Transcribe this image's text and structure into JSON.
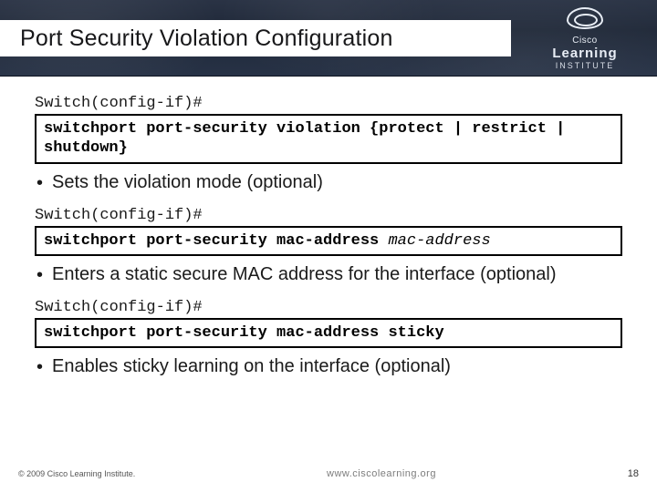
{
  "header": {
    "title": "Port Security Violation Configuration",
    "logo": {
      "brand": "Cisco",
      "word": "Learning",
      "sub": "INSTITUTE"
    }
  },
  "sections": [
    {
      "prompt": "Switch(config-if)#",
      "command_plain": "switchport port-security violation {protect | restrict | shutdown}",
      "arg_italic": "",
      "bullet": "Sets the violation mode (optional)"
    },
    {
      "prompt": "Switch(config-if)#",
      "command_plain": "switchport port-security mac-address ",
      "arg_italic": "mac-address",
      "bullet": "Enters a static secure MAC address for the interface (optional)"
    },
    {
      "prompt": "Switch(config-if)#",
      "command_plain": "switchport port-security mac-address sticky",
      "arg_italic": "",
      "bullet": "Enables sticky learning on the interface (optional)"
    }
  ],
  "footer": {
    "copyright": "© 2009 Cisco Learning Institute.",
    "url": "www.ciscolearning.org",
    "page": "18"
  }
}
